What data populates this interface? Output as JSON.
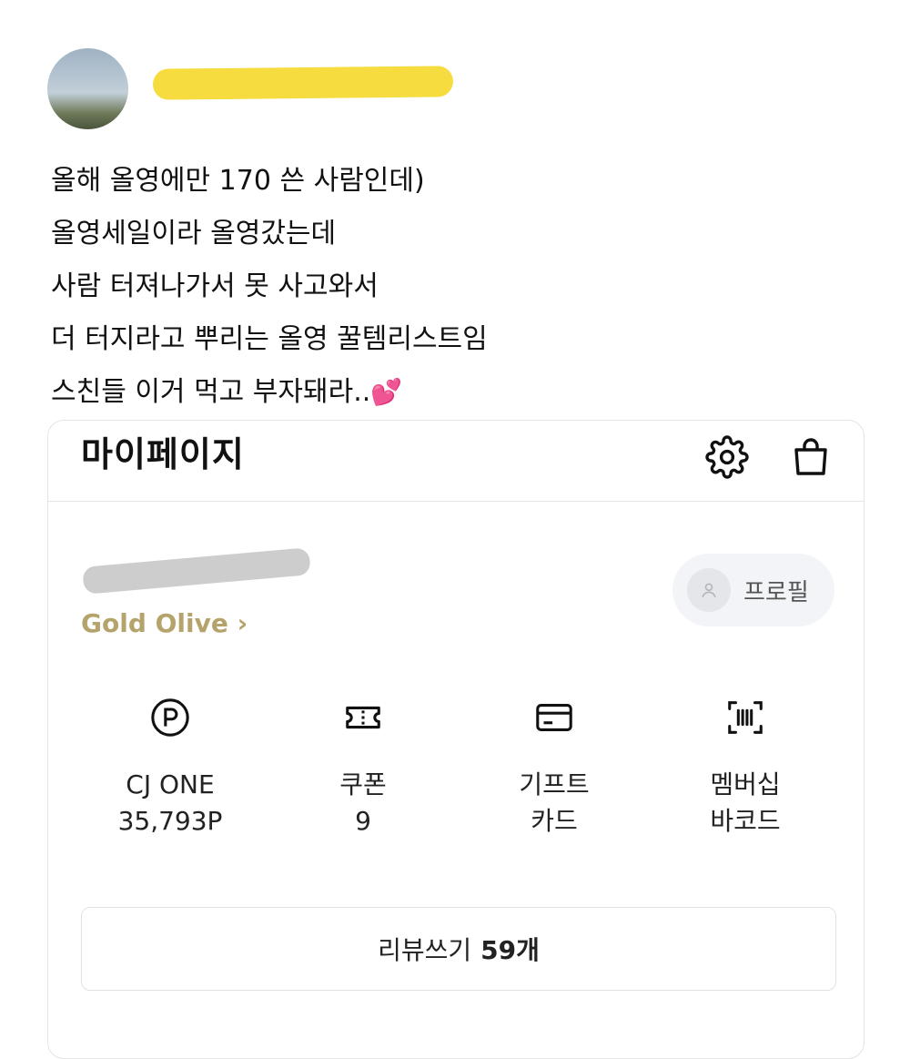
{
  "post": {
    "lines": [
      "올해 올영에만 170 쓴 사람인데)",
      "올영세일이라 올영갔는데",
      "사람 터져나가서 못 사고와서",
      "더 터지라고 뿌리는 올영 꿀템리스트임",
      "스친들 이거 먹고 부자돼라.."
    ],
    "emoji": "💕"
  },
  "mypage": {
    "title": "마이페이지",
    "grade": "Gold Olive",
    "grade_chevron": "›",
    "profile_label": "프로필",
    "quick_links": [
      {
        "icon": "point-icon",
        "line1": "CJ ONE",
        "line2": "35,793P"
      },
      {
        "icon": "coupon-icon",
        "line1": "쿠폰",
        "line2": "9"
      },
      {
        "icon": "gift-card-icon",
        "line1": "기프트",
        "line2": "카드"
      },
      {
        "icon": "barcode-icon",
        "line1": "멤버십",
        "line2": "바코드"
      }
    ],
    "review_label": "리뷰쓰기",
    "review_count": "59개"
  },
  "colors": {
    "grade_gold": "#b5a36c",
    "redaction_yellow": "#f6dc3f",
    "redaction_gray": "#c8c8c8"
  }
}
